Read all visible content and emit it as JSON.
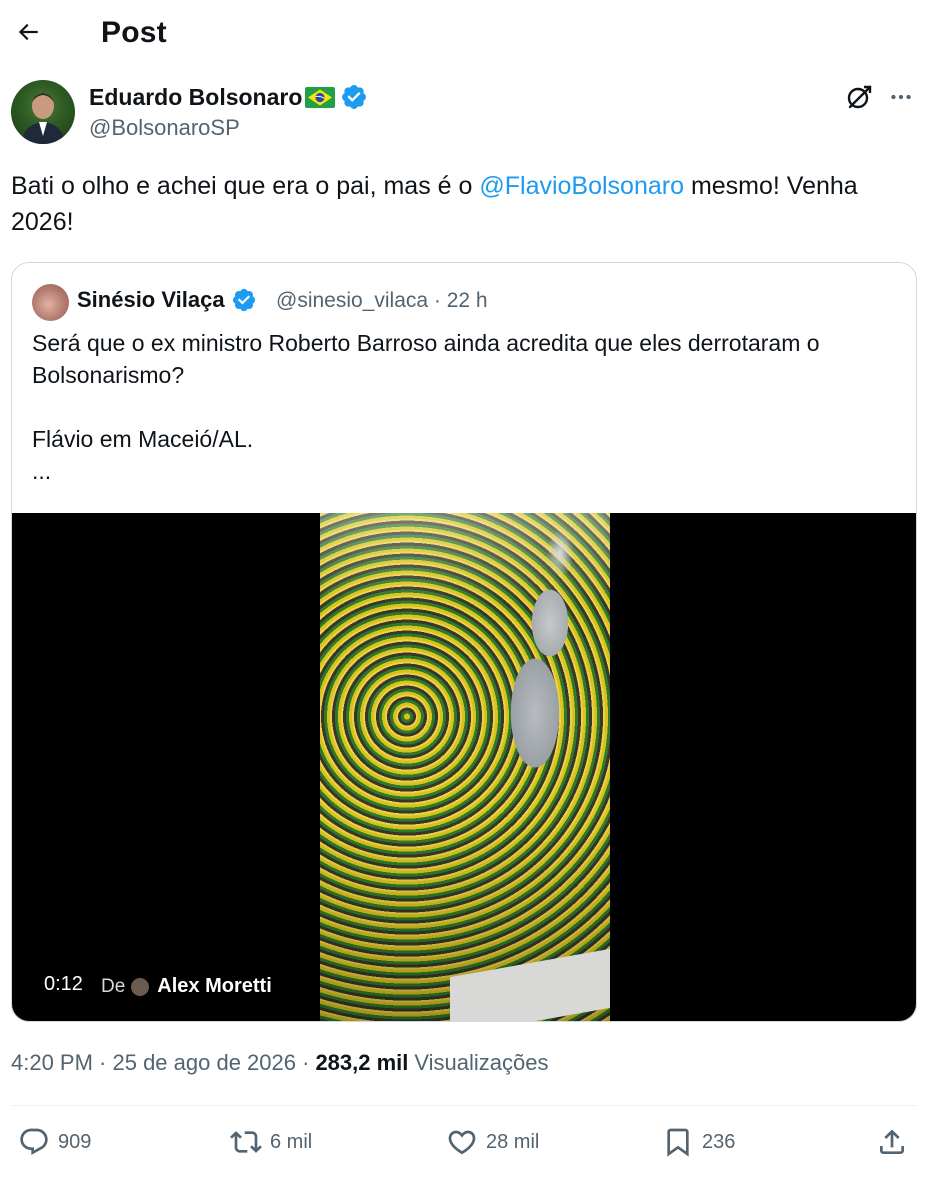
{
  "header": {
    "title": "Post",
    "back_icon": "arrow-left-icon"
  },
  "post": {
    "author": {
      "name": "Eduardo Bolsonaro",
      "flag": "brazil-flag-icon",
      "verified": true,
      "handle": "@BolsonaroSP"
    },
    "text_before": "Bati o olho e achei que era o pai, mas é o ",
    "mention": "@FlavioBolsonaro",
    "text_after": " mesmo! Venha 2026!",
    "timestamp": "4:20 PM · 25 de ago de 2026 ·",
    "views_count": "283,2 mil",
    "views_label": "Visualizações"
  },
  "quote": {
    "author": {
      "name": "Sinésio Vilaça",
      "verified": true
    },
    "meta": "@sinesio_vilaca · 22 h",
    "text": "Será que o ex ministro Roberto Barroso ainda acredita que eles derrotaram o Bolsonarismo?\n\nFlávio em Maceió/AL.\n...",
    "video": {
      "duration": "0:12",
      "from_label": "De",
      "from_author": "Alex Moretti"
    }
  },
  "actions": {
    "replies": "909",
    "reposts": "6 mil",
    "likes": "28 mil",
    "bookmarks": "236"
  },
  "colors": {
    "accent": "#1d9bf0",
    "secondary_text": "#536471",
    "primary_text": "#0f1419",
    "border": "#cfd9de"
  }
}
